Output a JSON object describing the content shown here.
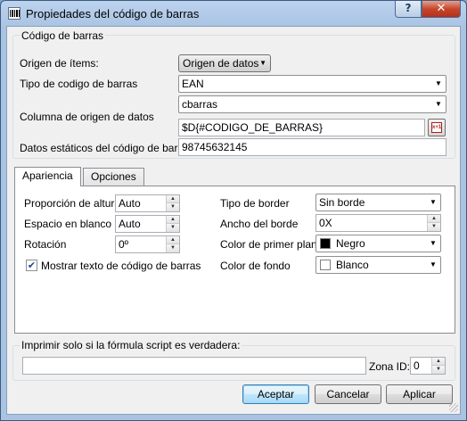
{
  "window": {
    "title": "Propiedades del código de barras",
    "help_label": "?",
    "close_label": "✕",
    "icon": "barcode-icon"
  },
  "barcode_group": {
    "title": "Código de barras",
    "origin_items_label": "Origen de ítems:",
    "origin_items_value": "Origen de datos",
    "barcode_type_label": "Tipo de codigo de barras",
    "barcode_type_value": "EAN",
    "source_column_label": "Columna de origen de datos",
    "source_column_value": "cbarras",
    "expression_value": "$D{#CODIGO_DE_BARRAS}",
    "expression_button_icon": "formula-editor-icon",
    "static_data_label": "Datos estáticos del código de barras",
    "static_data_value": "98745632145"
  },
  "tabs": [
    {
      "label": "Apariencia",
      "active": true
    },
    {
      "label": "Opciones",
      "active": false
    }
  ],
  "appearance": {
    "height_ratio_label": "Proporción de altura",
    "height_ratio_value": "Auto",
    "blank_space_label": "Espacio en blanco",
    "blank_space_value": "Auto",
    "rotation_label": "Rotación",
    "rotation_value": "0º",
    "show_text_label": "Mostrar texto de código de barras",
    "show_text_checked": true,
    "border_type_label": "Tipo de border",
    "border_type_value": "Sin borde",
    "border_width_label": "Ancho del borde",
    "border_width_value": "0X",
    "foreground_label": "Color de primer plano",
    "foreground_value": "Negro",
    "foreground_color": "#000000",
    "background_label": "Color de fondo",
    "background_value": "Blanco",
    "background_color": "#ffffff"
  },
  "print_condition": {
    "title": "Imprimir solo si la fórmula script es verdadera:",
    "formula_value": "",
    "zone_id_label": "Zona ID:",
    "zone_id_value": "0"
  },
  "buttons": {
    "accept": "Aceptar",
    "cancel": "Cancelar",
    "apply": "Aplicar"
  },
  "colors": {
    "title_bar": "#a9c3e3",
    "close_button": "#c6472d",
    "dialog_bg": "#f0f0f0",
    "default_button": "#bee6fd"
  }
}
